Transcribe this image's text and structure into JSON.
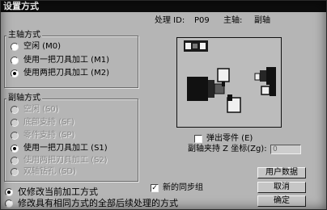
{
  "window": {
    "title": "设置方式"
  },
  "header": {
    "process_id_label": "处理 ID:",
    "process_id_value": "P09",
    "spindle_label": "主轴:",
    "spindle_value": "副轴"
  },
  "main_spindle": {
    "title": "主轴方式",
    "options": [
      {
        "label": "空闲 (M0)",
        "selected": false,
        "disabled": false
      },
      {
        "label": "使用一把刀具加工 (M1)",
        "selected": false,
        "disabled": false
      },
      {
        "label": "使用两把刀具加工 (M2)",
        "selected": true,
        "disabled": false
      }
    ]
  },
  "sub_spindle": {
    "title": "副轴方式",
    "options": [
      {
        "label": "空闲 (S0)",
        "selected": false,
        "disabled": true
      },
      {
        "label": "底部支持 (SF)",
        "selected": false,
        "disabled": true
      },
      {
        "label": "零件支持 (SP)",
        "selected": false,
        "disabled": true
      },
      {
        "label": "使用一把刀具加工 (S1)",
        "selected": true,
        "disabled": false
      },
      {
        "label": "使用两把刀具加工 (S2)",
        "selected": false,
        "disabled": true
      },
      {
        "label": "双轴钻孔 (SD)",
        "selected": false,
        "disabled": true
      }
    ]
  },
  "scope": {
    "options": [
      {
        "label": "仅修改当前加工方式",
        "selected": true
      },
      {
        "label": "修改具有相同方式的全部后续处理的方式",
        "selected": false
      }
    ]
  },
  "sync_group": {
    "label": "新的同步组",
    "checked": true
  },
  "eject_part": {
    "label": "弹出零件 (E)",
    "checked": false
  },
  "sub_clamp_z": {
    "label": "副轴夹持 Z 坐标(Zg):",
    "value": "0"
  },
  "buttons": {
    "user_data": "用户数据",
    "cancel": "取消",
    "ok": "确定"
  },
  "preview": {
    "icon": "machine-layout-icon"
  },
  "colors": {
    "dialog_bg": "#b5b5b5",
    "title_bg": "#0d0d0d",
    "title_text": "#ffffff",
    "disabled_text": "#8a8a8a"
  }
}
